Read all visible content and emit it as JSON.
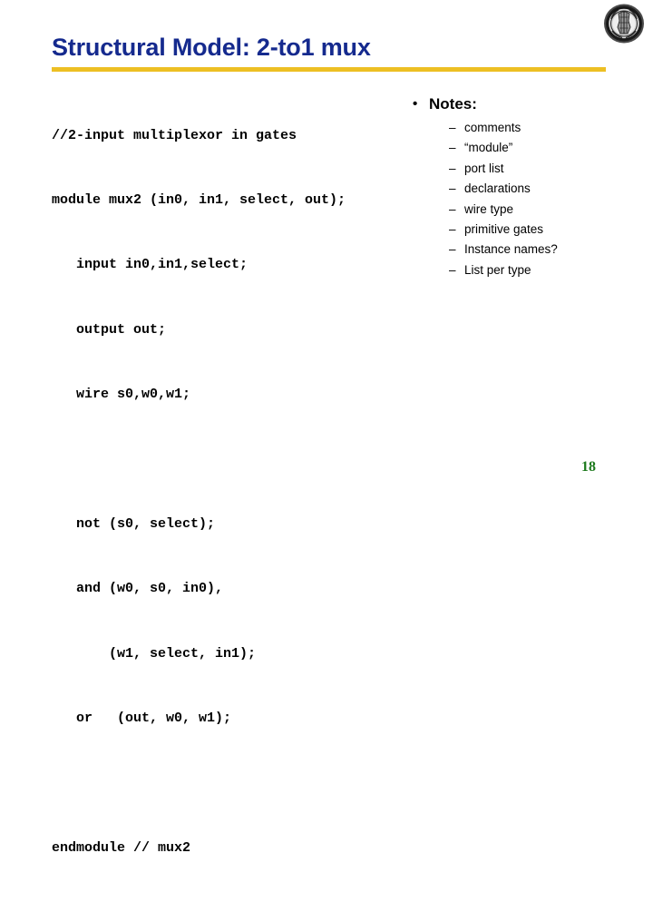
{
  "slide": {
    "title": "Structural Model: 2-to1 mux",
    "title_color": "#152a8e",
    "divider_color": "#edbf23",
    "background_color": "#ffffff",
    "page_number": "18",
    "page_number_color": "#1d7a1d",
    "logo_name": "university-seal-logo"
  },
  "code": {
    "language": "verilog",
    "lines": [
      "//2-input multiplexor in gates",
      "module mux2 (in0, in1, select, out);",
      "   input in0,in1,select;",
      "   output out;",
      "   wire s0,w0,w1;",
      "",
      "   not (s0, select);",
      "   and (w0, s0, in0),",
      "       (w1, select, in1);",
      "   or   (out, w0, w1);",
      "",
      "endmodule // mux2"
    ]
  },
  "notes": {
    "bullet_glyph": "•",
    "dash_glyph": "–",
    "heading": "Notes:",
    "items": [
      "comments",
      "“module”",
      "port list",
      "declarations",
      "wire type",
      "primitive gates",
      "Instance names?",
      "List per type"
    ]
  }
}
